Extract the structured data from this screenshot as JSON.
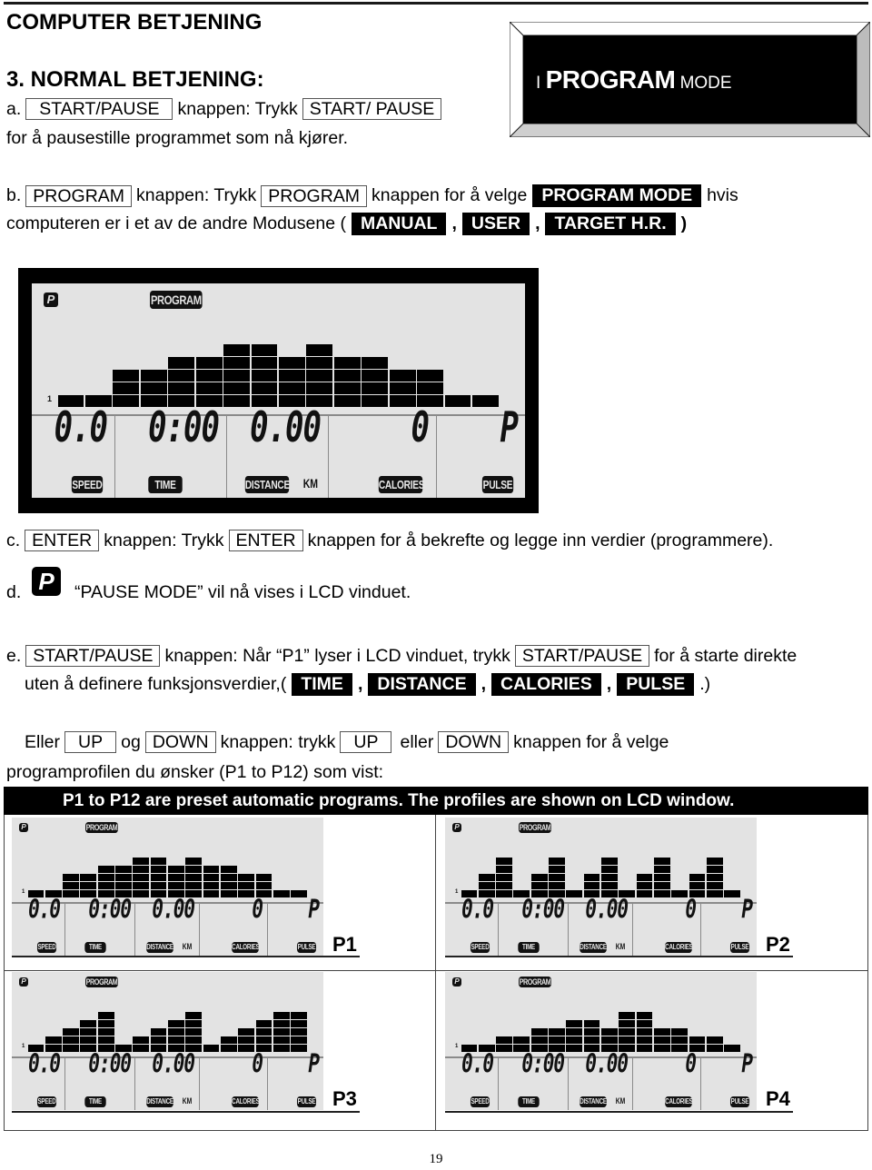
{
  "header": {
    "section_title": "COMPUTER BETJENING",
    "subsection_title": "3. NORMAL BETJENING:"
  },
  "mode_plate": {
    "prefix": "I",
    "big": "PROGRAM",
    "suffix": "MODE"
  },
  "item_a": {
    "marker": "a.",
    "key1": "START/PAUSE",
    "text1": "knappen: Trykk",
    "key2": "START/ PAUSE",
    "line2": "for å pausestille programmet som nå kjører."
  },
  "item_b": {
    "marker": "b.",
    "key1": "PROGRAM",
    "text1": "knappen: Trykk",
    "key2": "PROGRAM",
    "text2": "knappen for å velge",
    "mode": "PROGRAM MODE",
    "text3": "hvis",
    "line2": "computeren er i et av de andre Modusene (",
    "modes": [
      "MANUAL",
      "USER",
      "TARGET H.R."
    ],
    "close": ")"
  },
  "lcd": {
    "tag": "PROGRAM",
    "pause_icon": "P",
    "level_marker": "1",
    "readouts": {
      "speed": "0.0",
      "time": "0:00",
      "distance": "0.00",
      "calories": "0",
      "pulse": "P"
    },
    "labels": {
      "speed": "SPEED",
      "time": "TIME",
      "distance": "DISTANCE",
      "km": "KM",
      "calories": "CALORIES",
      "pulse": "PULSE"
    }
  },
  "main_profile": [
    1,
    1,
    3,
    3,
    4,
    4,
    5,
    5,
    4,
    5,
    4,
    4,
    3,
    3,
    1,
    1
  ],
  "item_c": {
    "marker": "c.",
    "key1": "ENTER",
    "text1": "knappen: Trykk",
    "key2": "ENTER",
    "text2": "knappen for å bekrefte og legge inn verdier (programmere)."
  },
  "item_d": {
    "marker": "d.",
    "icon": "P",
    "text": "“PAUSE MODE” vil nå vises i LCD vinduet."
  },
  "item_e": {
    "marker": "e.",
    "key1": "START/PAUSE",
    "text1": "knappen: Når “P1” lyser i LCD vinduet, trykk",
    "key2": "START/PAUSE",
    "text2": "for å starte direkte",
    "line2": "uten å definere funksjonsverdier,(",
    "values": [
      "TIME",
      "DISTANCE",
      "CALORIES",
      "PULSE"
    ],
    "close": ".)"
  },
  "item_updown": {
    "w1": "Eller",
    "key1": "UP",
    "w2": "og",
    "key2": "DOWN",
    "w3": "knappen: trykk",
    "key3": "UP",
    "w4": "eller",
    "key4": "DOWN",
    "w5": "knappen for å velge",
    "line2": "programprofilen du ønsker (P1 to P12) som vist:"
  },
  "profiles_banner": "P1 to P12 are preset automatic programs. The profiles are shown on LCD window.",
  "profiles": [
    {
      "name": "P1",
      "levels": [
        1,
        1,
        3,
        3,
        4,
        4,
        5,
        5,
        4,
        5,
        4,
        4,
        3,
        3,
        1,
        1
      ]
    },
    {
      "name": "P2",
      "levels": [
        1,
        3,
        5,
        1,
        3,
        5,
        1,
        3,
        5,
        1,
        3,
        5,
        1,
        3,
        5,
        1
      ]
    },
    {
      "name": "P3",
      "levels": [
        1,
        2,
        3,
        4,
        5,
        1,
        2,
        3,
        4,
        5,
        1,
        2,
        3,
        4,
        5,
        5
      ]
    },
    {
      "name": "P4",
      "levels": [
        1,
        1,
        2,
        2,
        3,
        3,
        4,
        4,
        3,
        5,
        5,
        3,
        3,
        2,
        2,
        1
      ]
    }
  ],
  "page_number": "19"
}
